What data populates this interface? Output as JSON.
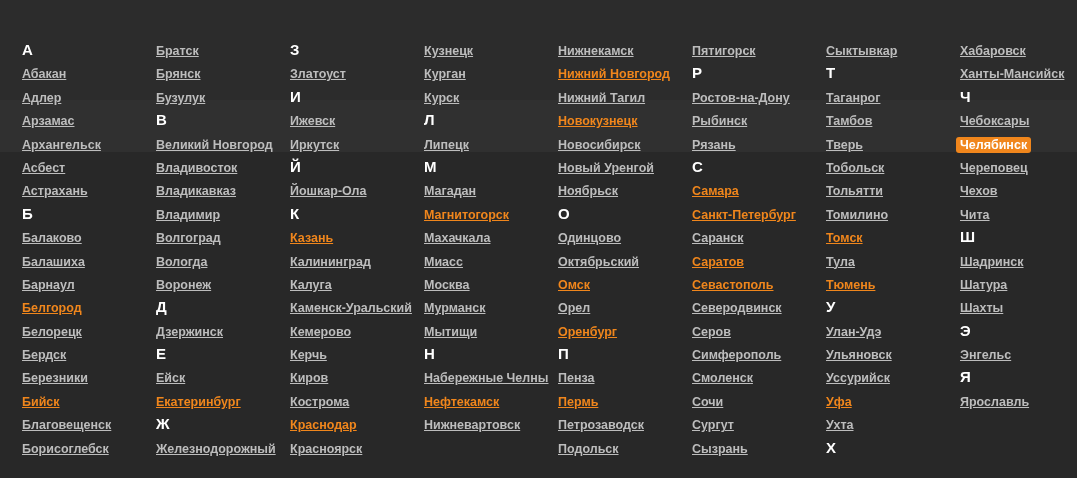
{
  "columns": [
    {
      "entries": [
        {
          "kind": "letter",
          "text": "А"
        },
        {
          "kind": "city",
          "text": "Абакан",
          "highlighted": false,
          "selected": false
        },
        {
          "kind": "city",
          "text": "Адлер",
          "highlighted": false,
          "selected": false
        },
        {
          "kind": "city",
          "text": "Арзамас",
          "highlighted": false,
          "selected": false
        },
        {
          "kind": "city",
          "text": "Архангельск",
          "highlighted": false,
          "selected": false
        },
        {
          "kind": "city",
          "text": "Асбест",
          "highlighted": false,
          "selected": false
        },
        {
          "kind": "city",
          "text": "Астрахань",
          "highlighted": false,
          "selected": false
        },
        {
          "kind": "letter",
          "text": "Б"
        },
        {
          "kind": "city",
          "text": "Балаково",
          "highlighted": false,
          "selected": false
        },
        {
          "kind": "city",
          "text": "Балашиха",
          "highlighted": false,
          "selected": false
        },
        {
          "kind": "city",
          "text": "Барнаул",
          "highlighted": false,
          "selected": false
        },
        {
          "kind": "city",
          "text": "Белгород",
          "highlighted": true,
          "selected": false
        },
        {
          "kind": "city",
          "text": "Белорецк",
          "highlighted": false,
          "selected": false
        },
        {
          "kind": "city",
          "text": "Бердск",
          "highlighted": false,
          "selected": false
        },
        {
          "kind": "city",
          "text": "Березники",
          "highlighted": false,
          "selected": false
        },
        {
          "kind": "city",
          "text": "Бийск",
          "highlighted": true,
          "selected": false
        },
        {
          "kind": "city",
          "text": "Благовещенск",
          "highlighted": false,
          "selected": false
        },
        {
          "kind": "city",
          "text": "Борисоглебск",
          "highlighted": false,
          "selected": false
        }
      ]
    },
    {
      "entries": [
        {
          "kind": "city",
          "text": "Братск",
          "highlighted": false,
          "selected": false
        },
        {
          "kind": "city",
          "text": "Брянск",
          "highlighted": false,
          "selected": false
        },
        {
          "kind": "city",
          "text": "Бузулук",
          "highlighted": false,
          "selected": false
        },
        {
          "kind": "letter",
          "text": "В"
        },
        {
          "kind": "city",
          "text": "Великий Новгород",
          "highlighted": false,
          "selected": false
        },
        {
          "kind": "city",
          "text": "Владивосток",
          "highlighted": false,
          "selected": false
        },
        {
          "kind": "city",
          "text": "Владикавказ",
          "highlighted": false,
          "selected": false
        },
        {
          "kind": "city",
          "text": "Владимир",
          "highlighted": false,
          "selected": false
        },
        {
          "kind": "city",
          "text": "Волгоград",
          "highlighted": false,
          "selected": false
        },
        {
          "kind": "city",
          "text": "Вологда",
          "highlighted": false,
          "selected": false
        },
        {
          "kind": "city",
          "text": "Воронеж",
          "highlighted": false,
          "selected": false
        },
        {
          "kind": "letter",
          "text": "Д"
        },
        {
          "kind": "city",
          "text": "Дзержинск",
          "highlighted": false,
          "selected": false
        },
        {
          "kind": "letter",
          "text": "Е"
        },
        {
          "kind": "city",
          "text": "Ейск",
          "highlighted": false,
          "selected": false
        },
        {
          "kind": "city",
          "text": "Екатеринбург",
          "highlighted": true,
          "selected": false
        },
        {
          "kind": "letter",
          "text": "Ж"
        },
        {
          "kind": "city",
          "text": "Железнодорожный",
          "highlighted": false,
          "selected": false
        }
      ]
    },
    {
      "entries": [
        {
          "kind": "letter",
          "text": "З"
        },
        {
          "kind": "city",
          "text": "Златоуст",
          "highlighted": false,
          "selected": false
        },
        {
          "kind": "letter",
          "text": "И"
        },
        {
          "kind": "city",
          "text": "Ижевск",
          "highlighted": false,
          "selected": false
        },
        {
          "kind": "city",
          "text": "Иркутск",
          "highlighted": false,
          "selected": false
        },
        {
          "kind": "letter",
          "text": "Й"
        },
        {
          "kind": "city",
          "text": "Йошкар-Ола",
          "highlighted": false,
          "selected": false
        },
        {
          "kind": "letter",
          "text": "К"
        },
        {
          "kind": "city",
          "text": "Казань",
          "highlighted": true,
          "selected": false
        },
        {
          "kind": "city",
          "text": "Калининград",
          "highlighted": false,
          "selected": false
        },
        {
          "kind": "city",
          "text": "Калуга",
          "highlighted": false,
          "selected": false
        },
        {
          "kind": "city",
          "text": "Каменск-Уральский",
          "highlighted": false,
          "selected": false
        },
        {
          "kind": "city",
          "text": "Кемерово",
          "highlighted": false,
          "selected": false
        },
        {
          "kind": "city",
          "text": "Керчь",
          "highlighted": false,
          "selected": false
        },
        {
          "kind": "city",
          "text": "Киров",
          "highlighted": false,
          "selected": false
        },
        {
          "kind": "city",
          "text": "Кострома",
          "highlighted": false,
          "selected": false
        },
        {
          "kind": "city",
          "text": "Краснодар",
          "highlighted": true,
          "selected": false
        },
        {
          "kind": "city",
          "text": "Красноярск",
          "highlighted": false,
          "selected": false
        }
      ]
    },
    {
      "entries": [
        {
          "kind": "city",
          "text": "Кузнецк",
          "highlighted": false,
          "selected": false
        },
        {
          "kind": "city",
          "text": "Курган",
          "highlighted": false,
          "selected": false
        },
        {
          "kind": "city",
          "text": "Курск",
          "highlighted": false,
          "selected": false
        },
        {
          "kind": "letter",
          "text": "Л"
        },
        {
          "kind": "city",
          "text": "Липецк",
          "highlighted": false,
          "selected": false
        },
        {
          "kind": "letter",
          "text": "М"
        },
        {
          "kind": "city",
          "text": "Магадан",
          "highlighted": false,
          "selected": false
        },
        {
          "kind": "city",
          "text": "Магнитогорск",
          "highlighted": true,
          "selected": false
        },
        {
          "kind": "city",
          "text": "Махачкала",
          "highlighted": false,
          "selected": false
        },
        {
          "kind": "city",
          "text": "Миасс",
          "highlighted": false,
          "selected": false
        },
        {
          "kind": "city",
          "text": "Москва",
          "highlighted": false,
          "selected": false
        },
        {
          "kind": "city",
          "text": "Мурманск",
          "highlighted": false,
          "selected": false
        },
        {
          "kind": "city",
          "text": "Мытищи",
          "highlighted": false,
          "selected": false
        },
        {
          "kind": "letter",
          "text": "Н"
        },
        {
          "kind": "city",
          "text": "Набережные Челны",
          "highlighted": false,
          "selected": false
        },
        {
          "kind": "city",
          "text": "Нефтекамск",
          "highlighted": true,
          "selected": false
        },
        {
          "kind": "city",
          "text": "Нижневартовск",
          "highlighted": false,
          "selected": false
        }
      ]
    },
    {
      "entries": [
        {
          "kind": "city",
          "text": "Нижнекамск",
          "highlighted": false,
          "selected": false
        },
        {
          "kind": "city",
          "text": "Нижний Новгород",
          "highlighted": true,
          "selected": false
        },
        {
          "kind": "city",
          "text": "Нижний Тагил",
          "highlighted": false,
          "selected": false
        },
        {
          "kind": "city",
          "text": "Новокузнецк",
          "highlighted": true,
          "selected": false
        },
        {
          "kind": "city",
          "text": "Новосибирск",
          "highlighted": false,
          "selected": false
        },
        {
          "kind": "city",
          "text": "Новый Уренгой",
          "highlighted": false,
          "selected": false
        },
        {
          "kind": "city",
          "text": "Ноябрьск",
          "highlighted": false,
          "selected": false
        },
        {
          "kind": "letter",
          "text": "О"
        },
        {
          "kind": "city",
          "text": "Одинцово",
          "highlighted": false,
          "selected": false
        },
        {
          "kind": "city",
          "text": "Октябрьский",
          "highlighted": false,
          "selected": false
        },
        {
          "kind": "city",
          "text": "Омск",
          "highlighted": true,
          "selected": false
        },
        {
          "kind": "city",
          "text": "Орел",
          "highlighted": false,
          "selected": false
        },
        {
          "kind": "city",
          "text": "Оренбург",
          "highlighted": true,
          "selected": false
        },
        {
          "kind": "letter",
          "text": "П"
        },
        {
          "kind": "city",
          "text": "Пенза",
          "highlighted": false,
          "selected": false
        },
        {
          "kind": "city",
          "text": "Пермь",
          "highlighted": true,
          "selected": false
        },
        {
          "kind": "city",
          "text": "Петрозаводск",
          "highlighted": false,
          "selected": false
        },
        {
          "kind": "city",
          "text": "Подольск",
          "highlighted": false,
          "selected": false
        }
      ]
    },
    {
      "entries": [
        {
          "kind": "city",
          "text": "Пятигорск",
          "highlighted": false,
          "selected": false
        },
        {
          "kind": "letter",
          "text": "Р"
        },
        {
          "kind": "city",
          "text": "Ростов-на-Дону",
          "highlighted": false,
          "selected": false
        },
        {
          "kind": "city",
          "text": "Рыбинск",
          "highlighted": false,
          "selected": false
        },
        {
          "kind": "city",
          "text": "Рязань",
          "highlighted": false,
          "selected": false
        },
        {
          "kind": "letter",
          "text": "С"
        },
        {
          "kind": "city",
          "text": "Самара",
          "highlighted": true,
          "selected": false
        },
        {
          "kind": "city",
          "text": "Санкт-Петербург",
          "highlighted": true,
          "selected": false
        },
        {
          "kind": "city",
          "text": "Саранск",
          "highlighted": false,
          "selected": false
        },
        {
          "kind": "city",
          "text": "Саратов",
          "highlighted": true,
          "selected": false
        },
        {
          "kind": "city",
          "text": "Севастополь",
          "highlighted": true,
          "selected": false
        },
        {
          "kind": "city",
          "text": "Северодвинск",
          "highlighted": false,
          "selected": false
        },
        {
          "kind": "city",
          "text": "Серов",
          "highlighted": false,
          "selected": false
        },
        {
          "kind": "city",
          "text": "Симферополь",
          "highlighted": false,
          "selected": false
        },
        {
          "kind": "city",
          "text": "Смоленск",
          "highlighted": false,
          "selected": false
        },
        {
          "kind": "city",
          "text": "Сочи",
          "highlighted": false,
          "selected": false
        },
        {
          "kind": "city",
          "text": "Сургут",
          "highlighted": false,
          "selected": false
        },
        {
          "kind": "city",
          "text": "Сызрань",
          "highlighted": false,
          "selected": false
        }
      ]
    },
    {
      "entries": [
        {
          "kind": "city",
          "text": "Сыктывкар",
          "highlighted": false,
          "selected": false
        },
        {
          "kind": "letter",
          "text": "Т"
        },
        {
          "kind": "city",
          "text": "Таганрог",
          "highlighted": false,
          "selected": false
        },
        {
          "kind": "city",
          "text": "Тамбов",
          "highlighted": false,
          "selected": false
        },
        {
          "kind": "city",
          "text": "Тверь",
          "highlighted": false,
          "selected": false
        },
        {
          "kind": "city",
          "text": "Тобольск",
          "highlighted": false,
          "selected": false
        },
        {
          "kind": "city",
          "text": "Тольятти",
          "highlighted": false,
          "selected": false
        },
        {
          "kind": "city",
          "text": "Томилино",
          "highlighted": false,
          "selected": false
        },
        {
          "kind": "city",
          "text": "Томск",
          "highlighted": true,
          "selected": false
        },
        {
          "kind": "city",
          "text": "Тула",
          "highlighted": false,
          "selected": false
        },
        {
          "kind": "city",
          "text": "Тюмень",
          "highlighted": true,
          "selected": false
        },
        {
          "kind": "letter",
          "text": "У"
        },
        {
          "kind": "city",
          "text": "Улан-Удэ",
          "highlighted": false,
          "selected": false
        },
        {
          "kind": "city",
          "text": "Ульяновск",
          "highlighted": false,
          "selected": false
        },
        {
          "kind": "city",
          "text": "Уссурийск",
          "highlighted": false,
          "selected": false
        },
        {
          "kind": "city",
          "text": "Уфа",
          "highlighted": true,
          "selected": false
        },
        {
          "kind": "city",
          "text": "Ухта",
          "highlighted": false,
          "selected": false
        },
        {
          "kind": "letter",
          "text": "Х"
        }
      ]
    },
    {
      "entries": [
        {
          "kind": "city",
          "text": "Хабаровск",
          "highlighted": false,
          "selected": false
        },
        {
          "kind": "city",
          "text": "Ханты-Мансийск",
          "highlighted": false,
          "selected": false
        },
        {
          "kind": "letter",
          "text": "Ч"
        },
        {
          "kind": "city",
          "text": "Чебоксары",
          "highlighted": false,
          "selected": false
        },
        {
          "kind": "city",
          "text": "Челябинск",
          "selected": true
        },
        {
          "kind": "city",
          "text": "Череповец",
          "highlighted": false,
          "selected": false
        },
        {
          "kind": "city",
          "text": "Чехов",
          "highlighted": false,
          "selected": false
        },
        {
          "kind": "city",
          "text": "Чита",
          "highlighted": false,
          "selected": false
        },
        {
          "kind": "letter",
          "text": "Ш"
        },
        {
          "kind": "city",
          "text": "Шадринск",
          "highlighted": false,
          "selected": false
        },
        {
          "kind": "city",
          "text": "Шатура",
          "highlighted": false,
          "selected": false
        },
        {
          "kind": "city",
          "text": "Шахты",
          "highlighted": false,
          "selected": false
        },
        {
          "kind": "letter",
          "text": "Э"
        },
        {
          "kind": "city",
          "text": "Энгельс",
          "highlighted": false,
          "selected": false
        },
        {
          "kind": "letter",
          "text": "Я"
        },
        {
          "kind": "city",
          "text": "Ярославль",
          "highlighted": false,
          "selected": false
        }
      ]
    }
  ]
}
